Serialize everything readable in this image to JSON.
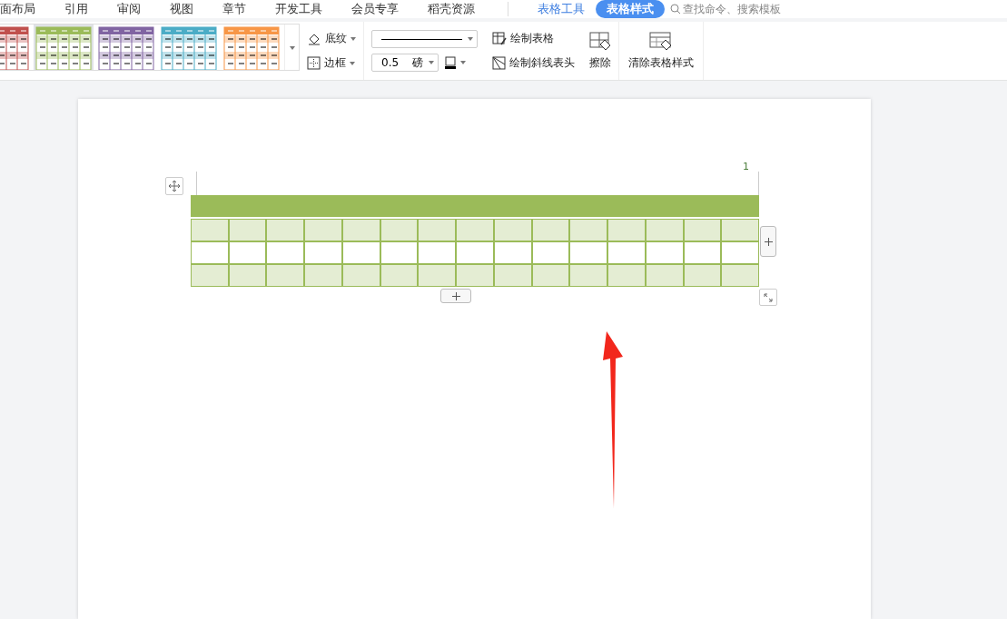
{
  "menu_tabs": [
    {
      "label": "面布局",
      "selected": false
    },
    {
      "label": "引用",
      "selected": false
    },
    {
      "label": "审阅",
      "selected": false
    },
    {
      "label": "视图",
      "selected": false
    },
    {
      "label": "章节",
      "selected": false
    },
    {
      "label": "开发工具",
      "selected": false
    },
    {
      "label": "会员专享",
      "selected": false
    },
    {
      "label": "稻壳资源",
      "selected": false
    }
  ],
  "context_tabs": [
    {
      "label": "表格工具",
      "selected": false
    },
    {
      "label": "表格样式",
      "selected": true
    }
  ],
  "search": {
    "placeholder": "查找命令、搜索模板"
  },
  "style_gallery": [
    {
      "color": "#c0504d",
      "selected": false
    },
    {
      "color": "#9bbb59",
      "selected": true
    },
    {
      "color": "#8064a2",
      "selected": false
    },
    {
      "color": "#4bacc6",
      "selected": false
    },
    {
      "color": "#f79646",
      "selected": false
    }
  ],
  "shading": {
    "label": "底纹"
  },
  "border": {
    "label": "边框"
  },
  "line_width": {
    "value": "0.5",
    "unit": "磅"
  },
  "draw_table": {
    "label": "绘制表格"
  },
  "draw_diagonal": {
    "label": "绘制斜线表头"
  },
  "erase": {
    "label": "擦除"
  },
  "clear_style": {
    "label": "清除表格样式"
  },
  "document": {
    "page_number": "1",
    "table": {
      "color": "#9bbb59",
      "rows": [
        {
          "kind": "header"
        },
        {
          "kind": "band"
        },
        {
          "kind": "plain"
        },
        {
          "kind": "band"
        }
      ]
    }
  }
}
